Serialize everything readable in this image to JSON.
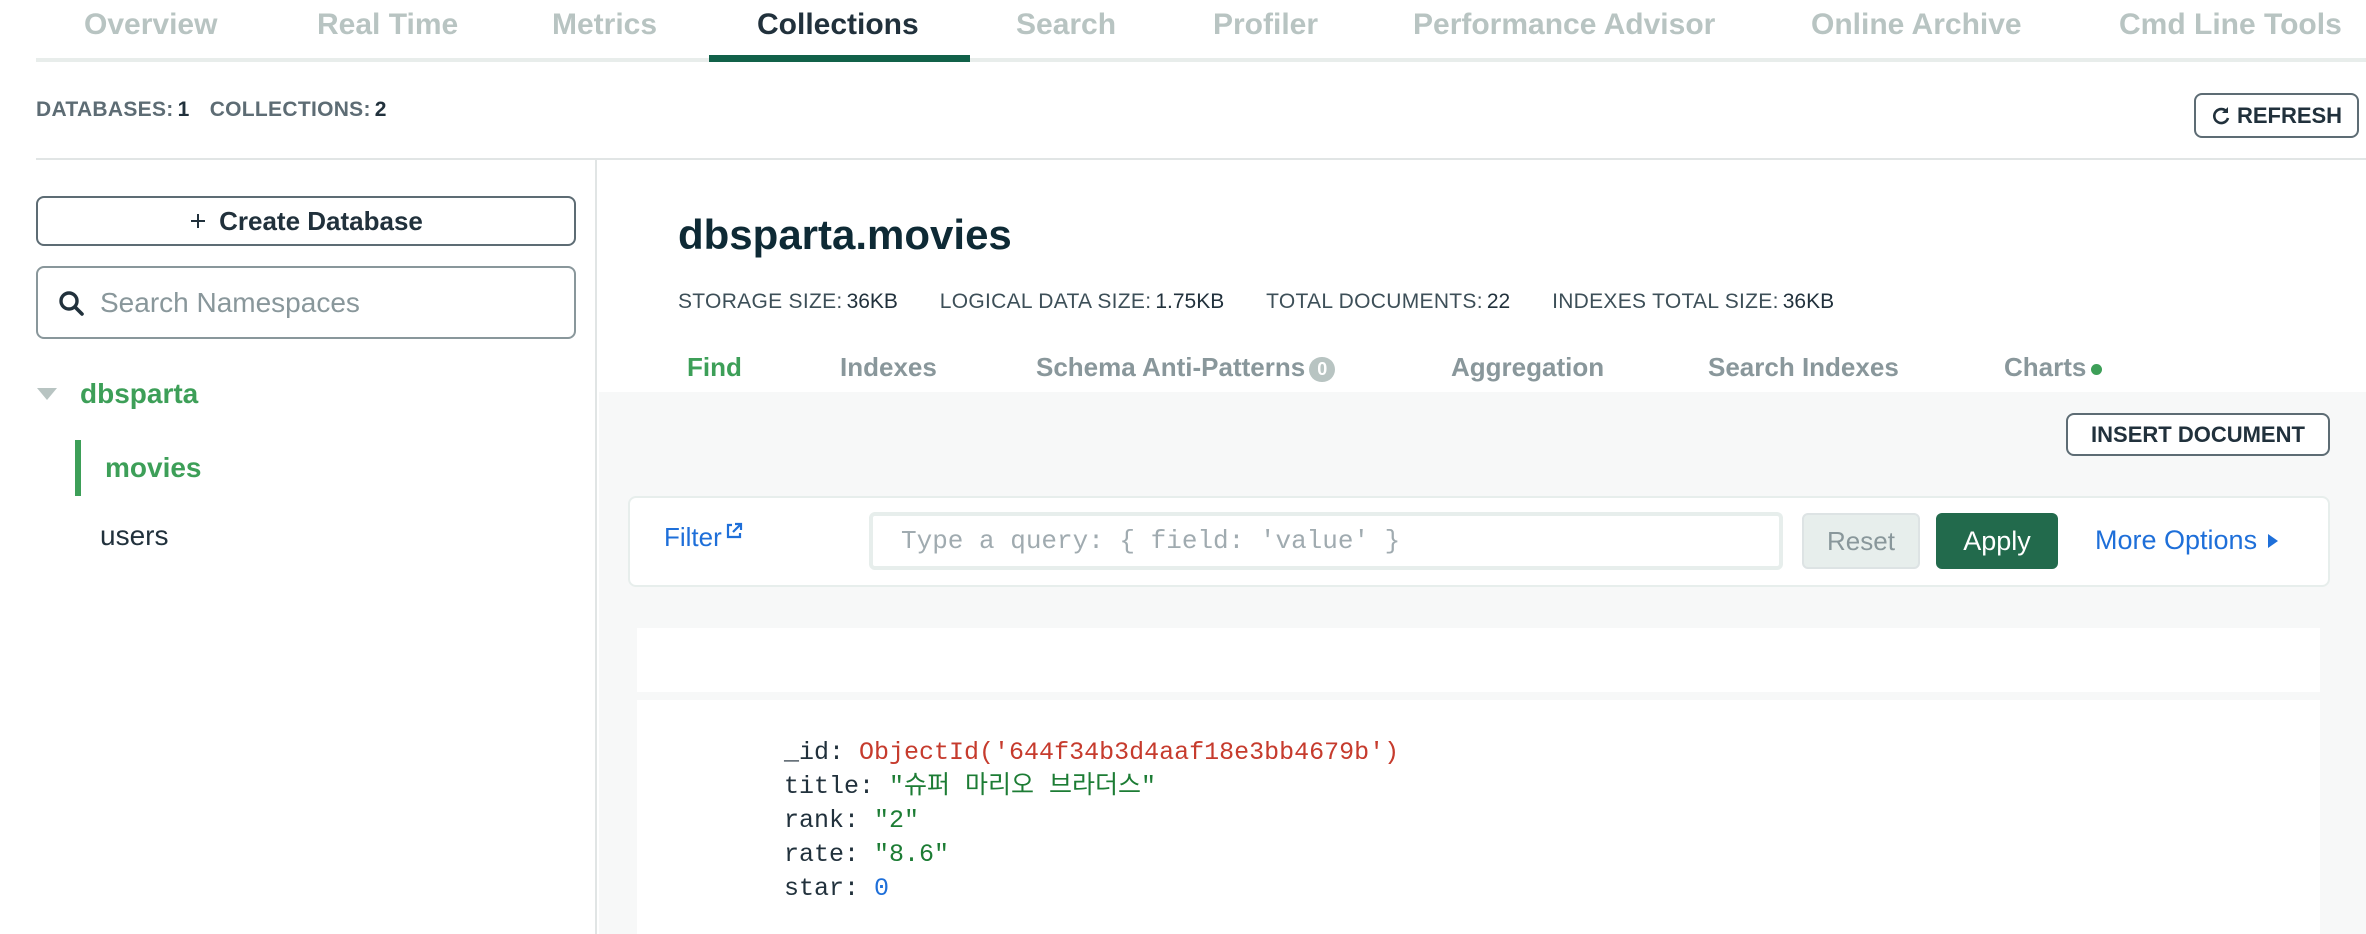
{
  "topnav": {
    "tabs": [
      {
        "label": "Overview",
        "active": false
      },
      {
        "label": "Real Time",
        "active": false
      },
      {
        "label": "Metrics",
        "active": false
      },
      {
        "label": "Collections",
        "active": true
      },
      {
        "label": "Search",
        "active": false
      },
      {
        "label": "Profiler",
        "active": false
      },
      {
        "label": "Performance Advisor",
        "active": false
      },
      {
        "label": "Online Archive",
        "active": false
      },
      {
        "label": "Cmd Line Tools",
        "active": false
      }
    ]
  },
  "stats": {
    "databases_label": "DATABASES:",
    "databases_value": "1",
    "collections_label": "COLLECTIONS:",
    "collections_value": "2",
    "refresh_label": "REFRESH",
    "refresh_icon": "refresh-icon"
  },
  "sidebar": {
    "create_db_label": "Create Database",
    "search_placeholder": "Search Namespaces",
    "database": "dbsparta",
    "collections": [
      {
        "name": "movies",
        "active": true
      },
      {
        "name": "users",
        "active": false
      }
    ]
  },
  "main": {
    "namespace": "dbsparta.movies",
    "storage_size_label": "STORAGE SIZE:",
    "storage_size": "36KB",
    "logical_size_label": "LOGICAL DATA SIZE:",
    "logical_size": "1.75KB",
    "total_docs_label": "TOTAL DOCUMENTS:",
    "total_docs": "22",
    "indexes_size_label": "INDEXES TOTAL SIZE:",
    "indexes_size": "36KB",
    "tabs": [
      {
        "label": "Find",
        "active": true
      },
      {
        "label": "Indexes"
      },
      {
        "label": "Schema Anti-Patterns",
        "badge": "0"
      },
      {
        "label": "Aggregation"
      },
      {
        "label": "Search Indexes"
      },
      {
        "label": "Charts",
        "dot_color": "#3d9f58"
      }
    ],
    "insert_label": "INSERT DOCUMENT",
    "query": {
      "filter_label": "Filter",
      "placeholder": "Type a query: { field: 'value' }",
      "reset_label": "Reset",
      "apply_label": "Apply",
      "more_options_label": "More Options"
    },
    "document": {
      "id_key": "_id:",
      "id_value": "ObjectId('644f34b3d4aaf18e3bb4679b')",
      "title_key": "title:",
      "title_value": "\"슈퍼 마리오 브라더스\"",
      "rank_key": "rank:",
      "rank_value": "\"2\"",
      "rate_key": "rate:",
      "rate_value": "\"8.6\"",
      "star_key": "star:",
      "star_value": "0"
    }
  },
  "colors": {
    "accent_green": "#3d9f58",
    "apply_button": "#226a4c",
    "link_blue": "#1e6fd9",
    "objectid_red": "#c63b2d"
  }
}
